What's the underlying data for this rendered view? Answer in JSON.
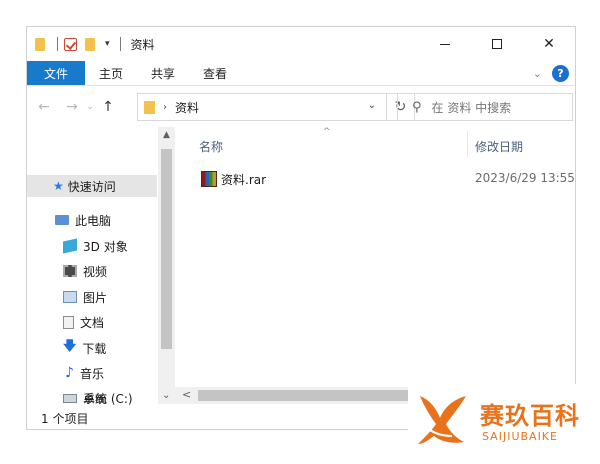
{
  "window": {
    "title": "资料",
    "controls": {
      "minimize": "—",
      "maximize": "☐",
      "close": "✕"
    }
  },
  "quick_access_toolbar": {
    "dropdown_glyph": "▾"
  },
  "ribbon": {
    "tabs": [
      "文件",
      "主页",
      "共享",
      "查看"
    ],
    "expand_glyph": "⌄",
    "help_glyph": "?"
  },
  "address_bar": {
    "back_glyph": "←",
    "forward_glyph": "→",
    "history_glyph": "⌄",
    "up_glyph": "↑",
    "crumb_sep": "›",
    "path": "资料",
    "dropdown_glyph": "⌄",
    "refresh_glyph": "↻"
  },
  "search": {
    "icon_glyph": "⚲",
    "placeholder": "在 资料 中搜索"
  },
  "nav_pane": {
    "quick_access": "快速访问",
    "items": [
      "此电脑",
      "3D 对象",
      "视频",
      "图片",
      "文档",
      "下载",
      "音乐",
      "桌面",
      "系统 (C:)"
    ],
    "star_glyph": "★",
    "down_glyph": "🡇",
    "music_glyph": "♪",
    "expand_glyph": "⌄"
  },
  "columns": {
    "name": "名称",
    "date": "修改日期",
    "sort_glyph": "^"
  },
  "files": [
    {
      "name": "资料.rar",
      "modified": "2023/6/29 13:55"
    }
  ],
  "scrollbars": {
    "up_glyph": "▲",
    "down_glyph": "▼",
    "left_glyph": "<"
  },
  "status": {
    "count": "1 个项目"
  },
  "watermark": {
    "brand": "赛玖百科",
    "brand_latin": "SAIJIUBAIKE",
    "color": "#e8731c"
  }
}
